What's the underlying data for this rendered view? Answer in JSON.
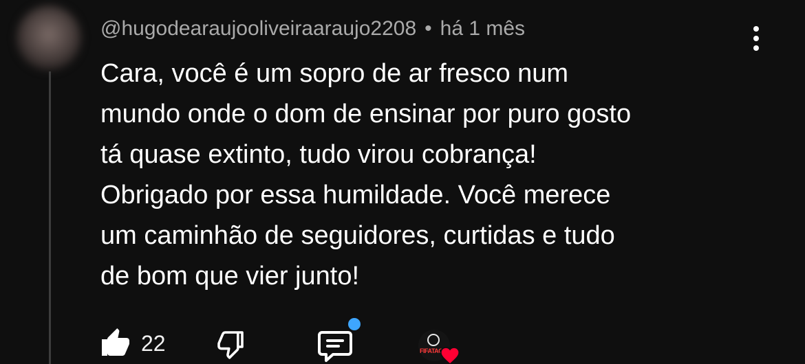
{
  "comment": {
    "author": "@hugodearaujooliveiraaraujo2208",
    "separator": "•",
    "timestamp": "há 1 mês",
    "text_lines": [
      "Cara, você é um sopro de ar fresco num",
      "mundo onde o dom de ensinar por puro gosto",
      "tá quase extinto, tudo virou cobrança!",
      "Obrigado por essa humildade. Você merece",
      "um caminhão de seguidores, curtidas e tudo",
      "de bom que vier junto!"
    ]
  },
  "actions": {
    "like_count": "22",
    "creator_logo_text": "FIFATAG"
  },
  "icons": {
    "like": "thumbs-up-filled-icon",
    "dislike": "thumbs-down-outline-icon",
    "reply": "comment-reply-icon",
    "menu": "kebab-menu-icon",
    "creator_heart": "heart-icon"
  },
  "colors": {
    "background": "#0f0f0f",
    "secondary_text": "#aaaaaa",
    "notification_dot": "#3ea6ff",
    "heart": "#ff0033"
  }
}
